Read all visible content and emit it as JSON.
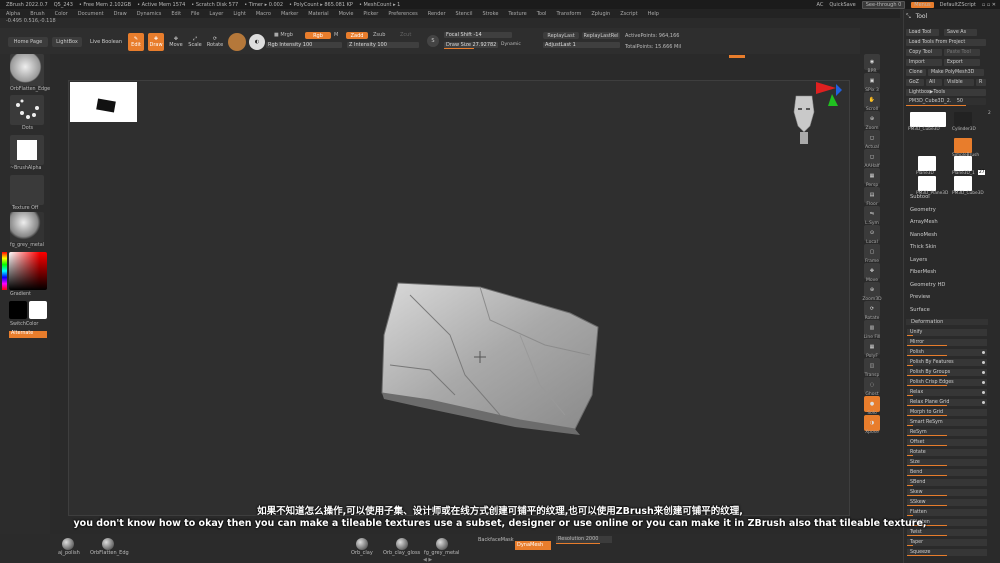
{
  "titlebar": {
    "app": "ZBrush 2022.0.7",
    "doc": "Q5_243",
    "free_mem": "• Free Mem 2.102GB",
    "active_mem": "• Active Mem 1574",
    "scratch": "• Scratch Disk 577",
    "timer": "• Timer ▸ 0.002",
    "polycount": "• PolyCount ▸ 865.081 KP",
    "meshcount": "• MeshCount ▸ 1",
    "ac": "AC",
    "quicksave": "QuickSave",
    "seethrough": "See-through 0",
    "menus": "Menus",
    "script": "DefaultZScript"
  },
  "menubar": [
    "Alpha",
    "Brush",
    "Color",
    "Document",
    "Draw",
    "Dynamics",
    "Edit",
    "File",
    "Layer",
    "Light",
    "Macro",
    "Marker",
    "Material",
    "Movie",
    "Picker",
    "Preferences",
    "Render",
    "Stencil",
    "Stroke",
    "Texture",
    "Tool",
    "Transform",
    "Zplugin",
    "Zscript",
    "Help"
  ],
  "coords": "-0.495 0.516,-0.118",
  "toolbar": {
    "home_page": "Home Page",
    "lightbox": "LightBox",
    "live_boolean": "Live Boolean",
    "edit": "Edit",
    "draw": "Draw",
    "move": "Move",
    "scale": "Scale",
    "rotate": "Rotate",
    "mrgb": "Mrgb",
    "rgb": "Rgb",
    "m": "M",
    "zadd": "Zadd",
    "zsub": "Zsub",
    "zcut": "Zcut",
    "rgb_intensity": "Rgb Intensity 100",
    "z_intensity": "Z Intensity 100",
    "focal_shift": "Focal Shift -14",
    "draw_size": "Draw Size 27.92782",
    "dynamic": "Dynamic",
    "replay_last": "ReplayLast",
    "replay_last_rel": "ReplayLastRel",
    "adjust_last": "AdjustLast 1",
    "active_points": "ActivePoints: 964,166",
    "total_points": "TotalPoints: 15.666 Mil"
  },
  "leftshelf": {
    "brush": "OrbFlatten_Edge",
    "stroke": "Dots",
    "alpha": "~BrushAlpha",
    "texture": "Texture Off",
    "material": "fg_grey_metal",
    "gradient": "Gradient",
    "switch_color": "SwitchColor",
    "alternate": "Alternate"
  },
  "rightcol": [
    "BPR",
    "SPix 3",
    "Scroll",
    "Zoom",
    "Actual",
    "AAHalf",
    "Persp",
    "Floor",
    "L.Sym",
    "Local",
    "Frame",
    "Move",
    "Zoom3D",
    "Rotate",
    "Line Fill",
    "PolyF",
    "Transp",
    "Ghost",
    "Solo",
    "Xpose"
  ],
  "toolpanel": {
    "title": "Tool",
    "load_tool": "Load Tool",
    "save_as": "Save As",
    "load_from_project": "Load Tools From Project",
    "copy_tool": "Copy Tool",
    "paste_tool": "Paste Tool",
    "import": "Import",
    "export": "Export",
    "clone": "Clone",
    "make_polymesh": "Make PolyMesh3D",
    "goz": "GoZ",
    "all": "All",
    "visible": "Visible",
    "r": "R",
    "lightbox_tools": "Lightbox▶Tools",
    "current_tool": "PM3D_Cube3D_2.",
    "current_tool_value": "50",
    "tools": [
      {
        "name": "PM3D_Cube3D"
      },
      {
        "name": "Cylinder3D"
      },
      {
        "name": "SimpleBrush"
      },
      {
        "name": "Plane3D"
      },
      {
        "name": "Plane3D_1"
      },
      {
        "name": "PM3D_Plane3D"
      },
      {
        "name": "PM3D_Cube3D"
      }
    ],
    "tool_count": "2",
    "tool_count_b": "27",
    "subpalettes": [
      "Subtool",
      "Geometry",
      "ArrayMesh",
      "NanoMesh",
      "Thick Skin",
      "Layers",
      "FiberMesh",
      "Geometry HD",
      "Preview",
      "Surface",
      "Deformation"
    ],
    "deformation": [
      "Unify",
      "Mirror",
      "Polish",
      "Polish By Features",
      "Polish By Groups",
      "Polish Crisp Edges",
      "Relax",
      "Relax Plane Grid",
      "Morph to Grid",
      "Smart ReSym",
      "ReSym",
      "Offset",
      "Rotate",
      "Size",
      "Bend",
      "SBend",
      "Skew",
      "SSkew",
      "Flatten",
      "SFlatten",
      "Twist",
      "Taper",
      "Squeeze"
    ]
  },
  "bottombar": {
    "brushes": [
      "aj_polish",
      "OrbFlatten_Edg"
    ],
    "materials": [
      "Orb_clay",
      "Orb_clay_gloss",
      "fg_grey_metal"
    ],
    "backface": "BackfaceMask",
    "dynamesh": "DynaMesh",
    "resolution": "Resolution 2000"
  },
  "subtitles": {
    "zh": "如果不知道怎么操作,可以使用子集、设计师或在线方式创建可铺平的纹理,也可以使用ZBrush来创建可铺平的纹理,",
    "en": "you don't know how to okay then you can make a tileable textures use a subset, designer or use online or you can make it in ZBrush also that tileable texture,"
  },
  "colors": {
    "accent": "#e87d2c",
    "panel": "#2a2a2a",
    "canvas": "#2f2f2f"
  }
}
